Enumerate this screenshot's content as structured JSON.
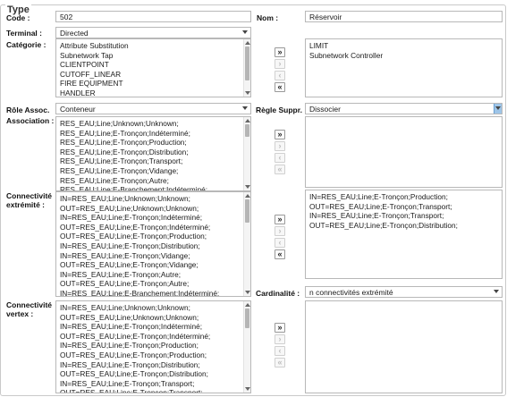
{
  "group_title": "Type",
  "labels": {
    "code": "Code :",
    "nom": "Nom :",
    "terminal": "Terminal :",
    "categorie": "Catégorie :",
    "role": "Rôle Assoc.",
    "regle": "Règle Suppr.",
    "association": "Association :",
    "conn_ext_1": "Connectivité",
    "conn_ext_2": "extrémité :",
    "cardinalite": "Cardinalité :",
    "conn_vert_1": "Connectivité",
    "conn_vert_2": "vertex :"
  },
  "fields": {
    "code": "502",
    "nom": "Réservoir",
    "terminal": "Directed",
    "role": "Conteneur",
    "regle": "Dissocier",
    "cardinalite": "n connectivités extrémité"
  },
  "buttons": {
    "add_all": "»",
    "add": "›",
    "remove": "‹",
    "remove_all": "«"
  },
  "lists": {
    "categorie_available": [
      "Attribute Substitution",
      "Subnetwork Tap",
      "CLIENTPOINT",
      "CUTOFF_LINEAR",
      "FIRE EQUIPMENT",
      "HANDLER"
    ],
    "categorie_selected": [
      "LIMIT",
      "Subnetwork Controller"
    ],
    "association_available": [
      "RES_EAU;Line;Unknown;Unknown;",
      "RES_EAU;Line;E-Tronçon;Indéterminé;",
      "RES_EAU;Line;E-Tronçon;Production;",
      "RES_EAU;Line;E-Tronçon;Distribution;",
      "RES_EAU;Line;E-Tronçon;Transport;",
      "RES_EAU;Line;E-Tronçon;Vidange;",
      "RES_EAU;Line;E-Tronçon;Autre;",
      "RES_EAU;Line;E-Branchement;Indéterminé;"
    ],
    "association_selected": [],
    "conn_ext_available": [
      "IN=RES_EAU;Line;Unknown;Unknown;",
      "OUT=RES_EAU;Line;Unknown;Unknown;",
      "IN=RES_EAU;Line;E-Tronçon;Indéterminé;",
      "OUT=RES_EAU;Line;E-Tronçon;Indéterminé;",
      "OUT=RES_EAU;Line;E-Tronçon;Production;",
      "IN=RES_EAU;Line;E-Tronçon;Distribution;",
      "IN=RES_EAU;Line;E-Tronçon;Vidange;",
      "OUT=RES_EAU;Line;E-Tronçon;Vidange;",
      "IN=RES_EAU;Line;E-Tronçon;Autre;",
      "OUT=RES_EAU;Line;E-Tronçon;Autre;",
      "IN=RES_EAU;Line;E-Branchement;Indéterminé;"
    ],
    "conn_ext_selected": [
      "IN=RES_EAU;Line;E-Tronçon;Production;",
      "OUT=RES_EAU;Line;E-Tronçon;Transport;",
      "IN=RES_EAU;Line;E-Tronçon;Transport;",
      "OUT=RES_EAU;Line;E-Tronçon;Distribution;"
    ],
    "conn_vert_available": [
      "IN=RES_EAU;Line;Unknown;Unknown;",
      "OUT=RES_EAU;Line;Unknown;Unknown;",
      "IN=RES_EAU;Line;E-Tronçon;Indéterminé;",
      "OUT=RES_EAU;Line;E-Tronçon;Indéterminé;",
      "IN=RES_EAU;Line;E-Tronçon;Production;",
      "OUT=RES_EAU;Line;E-Tronçon;Production;",
      "IN=RES_EAU;Line;E-Tronçon;Distribution;",
      "OUT=RES_EAU;Line;E-Tronçon;Distribution;",
      "IN=RES_EAU;Line;E-Tronçon;Transport;",
      "OUT=RES_EAU;Line;E-Tronçon;Transport;"
    ],
    "conn_vert_selected": []
  },
  "icons": {
    "add_all": "double-chevron-right-icon",
    "add": "chevron-right-icon",
    "remove": "chevron-left-icon",
    "remove_all": "double-chevron-left-icon",
    "dropdown": "chevron-down-icon"
  },
  "colors": {
    "active_dropdown": "#9ec5e8"
  }
}
